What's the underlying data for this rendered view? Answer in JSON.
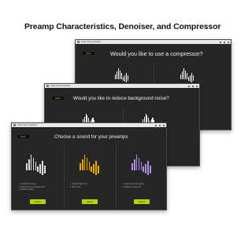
{
  "page_title": "Preamp Characteristics, Denoiser, and Compressor",
  "windows": {
    "compressor": {
      "title": "Audio Setup Assistant",
      "back_label": "Back",
      "question": "Would you like to use a compressor?"
    },
    "denoiser": {
      "title": "Audio Setup Assistant",
      "back_label": "Back",
      "question": "Would you like to reduce background noise?"
    },
    "preamp": {
      "title": "Audio Setup Assistant",
      "back_label": "Back",
      "question": "Choose a sound for your preamps",
      "options": [
        {
          "color": "#e0e0e0",
          "bullets": [
            "Uncoloured clarity",
            "Captures the raw signal and",
            "provides it later."
          ],
          "button_label": "Select"
        },
        {
          "color": "#f0a800",
          "bullets": [
            "Smooth high end",
            "Rich body"
          ],
          "button_label": "Select"
        },
        {
          "color": "#b48ce8",
          "bullets": [
            "Clean and crisp sound",
            "Brighten up any mic"
          ],
          "button_label": "Select"
        }
      ]
    }
  },
  "colors": {
    "accent": "#b5d300",
    "window_bg": "#262626",
    "titlebar": "#e9e9e9"
  },
  "icons": {
    "app": "app-icon",
    "minimize": "minimize-icon",
    "maximize": "maximize-icon",
    "close": "close-icon",
    "waveform": "waveform-icon"
  }
}
